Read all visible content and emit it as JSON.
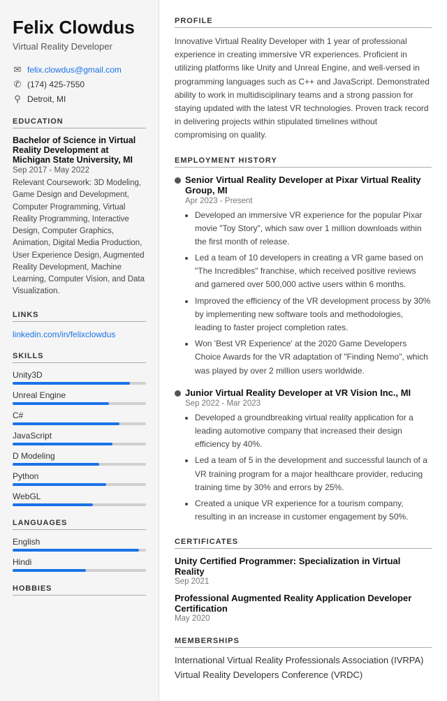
{
  "sidebar": {
    "name": "Felix Clowdus",
    "title": "Virtual Reality Developer",
    "contact": {
      "email": "felix.clowdus@gmail.com",
      "phone": "(174) 425-7550",
      "location": "Detroit, MI"
    },
    "education": {
      "section_label": "Education",
      "degree": "Bachelor of Science in Virtual Reality Development at Michigan State University, MI",
      "dates": "Sep 2017 - May 2022",
      "coursework_label": "Relevant Coursework:",
      "coursework": "3D Modeling, Game Design and Development, Computer Programming, Virtual Reality Programming, Interactive Design, Computer Graphics, Animation, Digital Media Production, User Experience Design, Augmented Reality Development, Machine Learning, Computer Vision, and Data Visualization."
    },
    "links": {
      "section_label": "Links",
      "linkedin": "linkedin.com/in/felixclowdus",
      "linkedin_href": "#"
    },
    "skills": {
      "section_label": "Skills",
      "items": [
        {
          "name": "Unity3D",
          "level": 88
        },
        {
          "name": "Unreal Engine",
          "level": 72
        },
        {
          "name": "C#",
          "level": 80
        },
        {
          "name": "JavaScript",
          "level": 75
        },
        {
          "name": "D Modeling",
          "level": 65
        },
        {
          "name": "Python",
          "level": 70
        },
        {
          "name": "WebGL",
          "level": 60
        }
      ]
    },
    "languages": {
      "section_label": "Languages",
      "items": [
        {
          "name": "English",
          "level": 95
        },
        {
          "name": "Hindi",
          "level": 55
        }
      ]
    },
    "hobbies": {
      "section_label": "Hobbies"
    }
  },
  "main": {
    "profile": {
      "section_label": "Profile",
      "text": "Innovative Virtual Reality Developer with 1 year of professional experience in creating immersive VR experiences. Proficient in utilizing platforms like Unity and Unreal Engine, and well-versed in programming languages such as C++ and JavaScript. Demonstrated ability to work in multidisciplinary teams and a strong passion for staying updated with the latest VR technologies. Proven track record in delivering projects within stipulated timelines without compromising on quality."
    },
    "employment": {
      "section_label": "Employment History",
      "jobs": [
        {
          "title": "Senior Virtual Reality Developer at Pixar Virtual Reality Group, MI",
          "dates": "Apr 2023 - Present",
          "bullets": [
            "Developed an immersive VR experience for the popular Pixar movie \"Toy Story\", which saw over 1 million downloads within the first month of release.",
            "Led a team of 10 developers in creating a VR game based on \"The Incredibles\" franchise, which received positive reviews and garnered over 500,000 active users within 6 months.",
            "Improved the efficiency of the VR development process by 30% by implementing new software tools and methodologies, leading to faster project completion rates.",
            "Won 'Best VR Experience' at the 2020 Game Developers Choice Awards for the VR adaptation of \"Finding Nemo\", which was played by over 2 million users worldwide."
          ]
        },
        {
          "title": "Junior Virtual Reality Developer at VR Vision Inc., MI",
          "dates": "Sep 2022 - Mar 2023",
          "bullets": [
            "Developed a groundbreaking virtual reality application for a leading automotive company that increased their design efficiency by 40%.",
            "Led a team of 5 in the development and successful launch of a VR training program for a major healthcare provider, reducing training time by 30% and errors by 25%.",
            "Created a unique VR experience for a tourism company, resulting in an increase in customer engagement by 50%."
          ]
        }
      ]
    },
    "certificates": {
      "section_label": "Certificates",
      "items": [
        {
          "name": "Unity Certified Programmer: Specialization in Virtual Reality",
          "date": "Sep 2021"
        },
        {
          "name": "Professional Augmented Reality Application Developer Certification",
          "date": "May 2020"
        }
      ]
    },
    "memberships": {
      "section_label": "Memberships",
      "items": [
        "International Virtual Reality Professionals Association (IVRPA)",
        "Virtual Reality Developers Conference (VRDC)"
      ]
    }
  }
}
